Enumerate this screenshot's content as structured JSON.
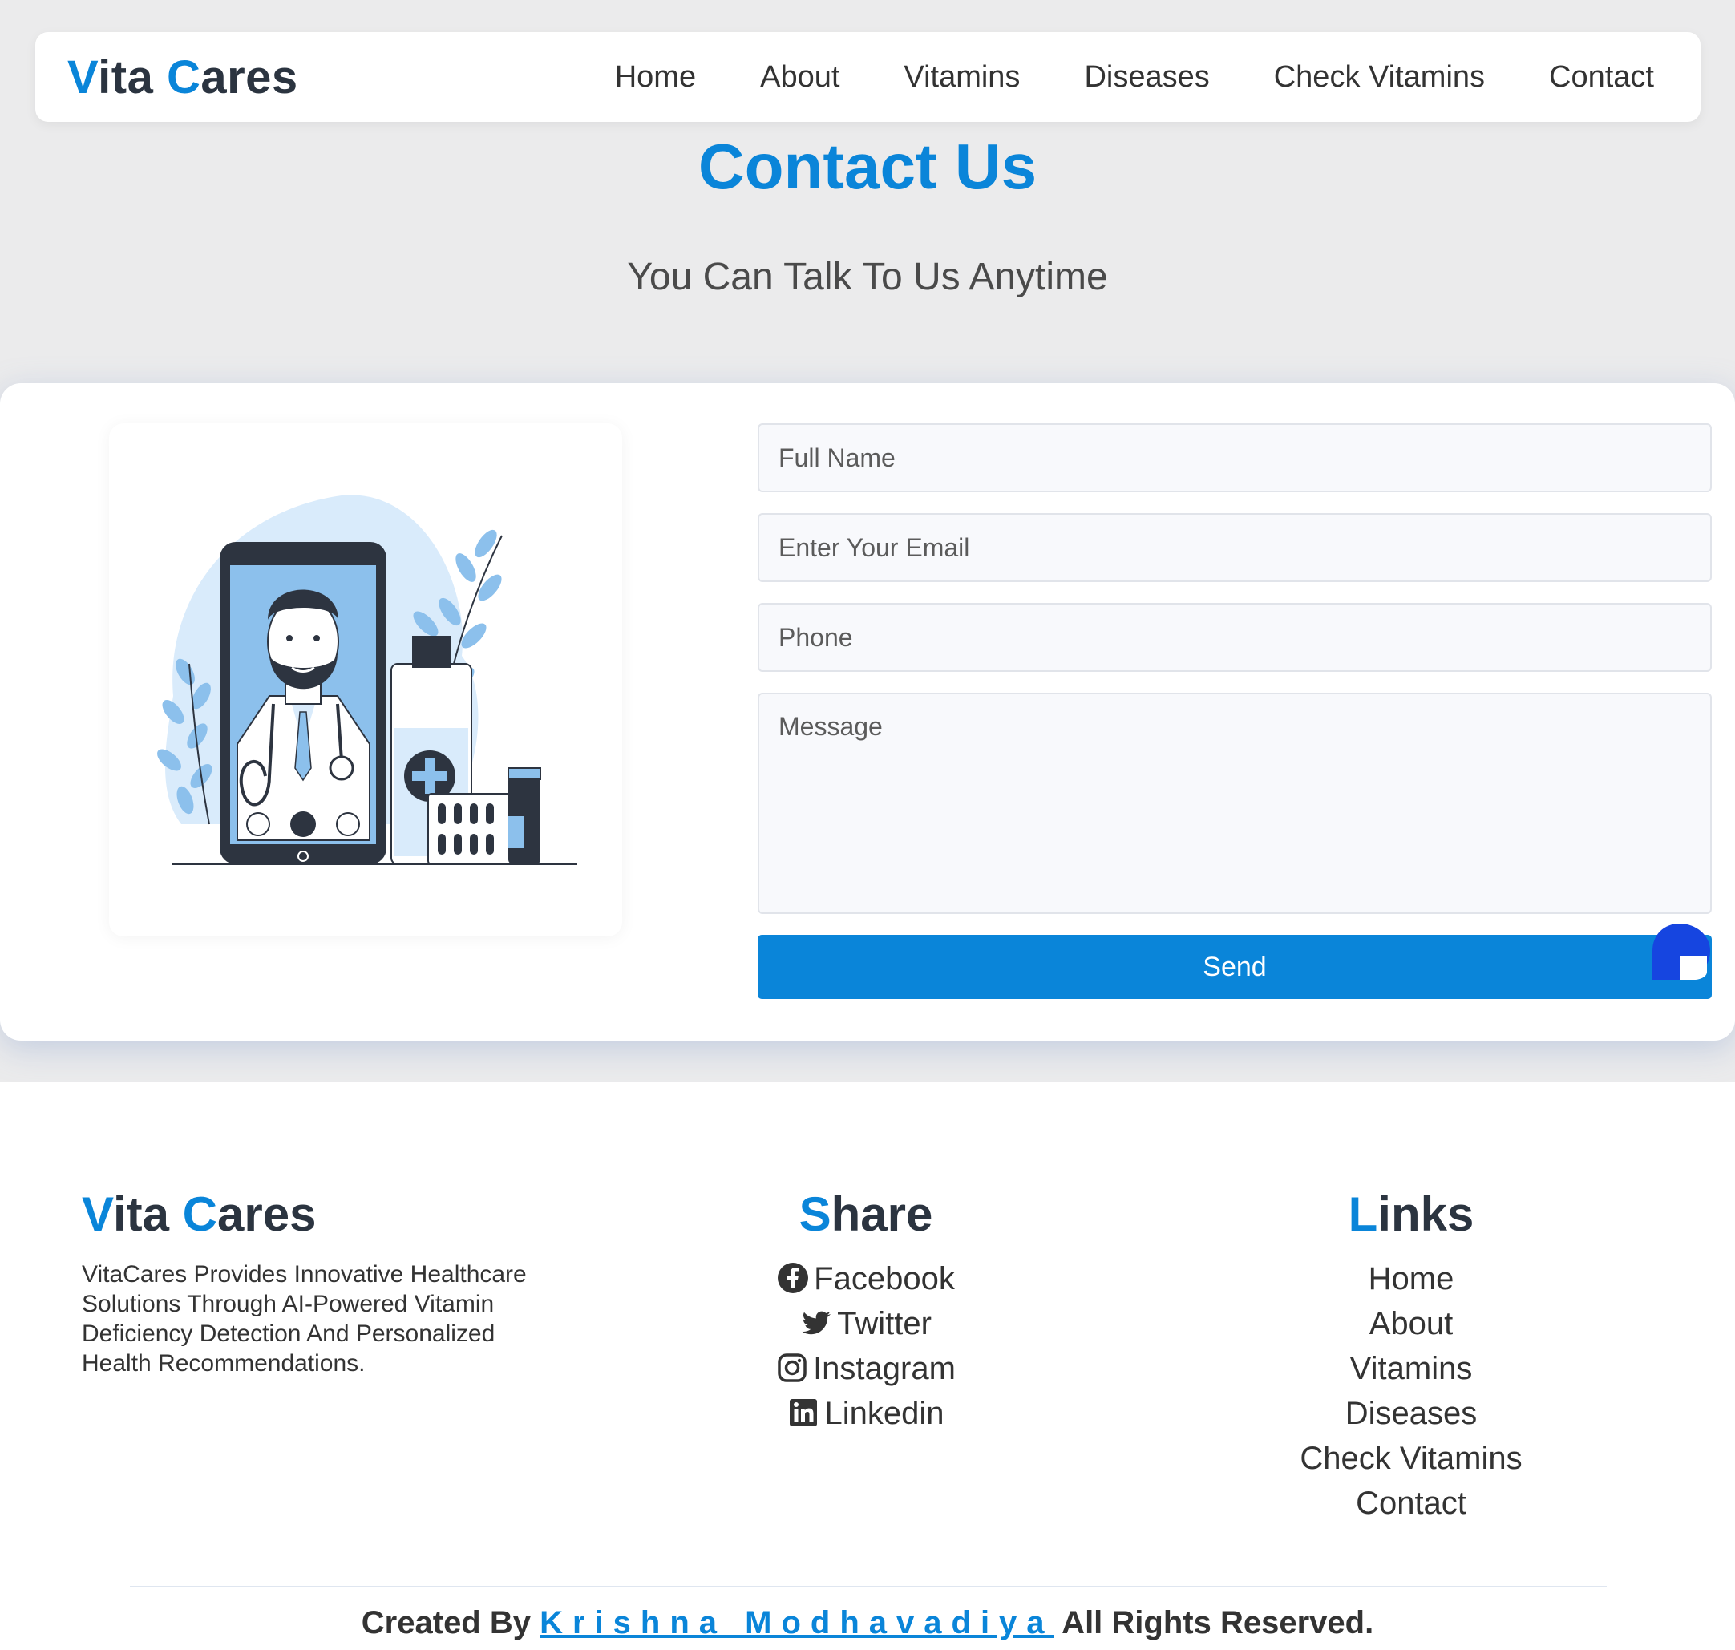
{
  "header": {
    "logo_initial_1": "V",
    "logo_rest_1": "ita",
    "logo_initial_2": "C",
    "logo_rest_2": "ares",
    "nav": [
      "Home",
      "About",
      "Vitamins",
      "Diseases",
      "Check Vitamins",
      "Contact"
    ]
  },
  "hero": {
    "title": "Contact Us",
    "subtitle": "You Can Talk To Us Anytime"
  },
  "form": {
    "name_placeholder": "Full Name",
    "email_placeholder": "Enter Your Email",
    "phone_placeholder": "Phone",
    "message_placeholder": "Message",
    "send_label": "Send"
  },
  "footer": {
    "brand_initial_1": "V",
    "brand_rest_1": "ita",
    "brand_initial_2": "C",
    "brand_rest_2": "ares",
    "about_text": "VitaCares Provides Innovative Healthcare Solutions Through AI-Powered Vitamin Deficiency Detection And Personalized Health Recommendations.",
    "share_initial": "S",
    "share_rest": "hare",
    "share_items": [
      "Facebook",
      "Twitter",
      "Instagram",
      "Linkedin"
    ],
    "links_initial": "L",
    "links_rest": "inks",
    "link_items": [
      "Home",
      "About",
      "Vitamins",
      "Diseases",
      "Check Vitamins",
      "Contact"
    ],
    "credits_prefix": "Created By ",
    "author": "Krishna Modhavadiya",
    "credits_suffix": " All Rights Reserved."
  },
  "colors": {
    "accent": "#0a85d9",
    "dark_text": "#2b3440",
    "page_bg": "#ebebec",
    "chat_icon": "#1645e0"
  },
  "icons": [
    "facebook-icon",
    "twitter-icon",
    "instagram-icon",
    "linkedin-icon",
    "chat-icon"
  ]
}
